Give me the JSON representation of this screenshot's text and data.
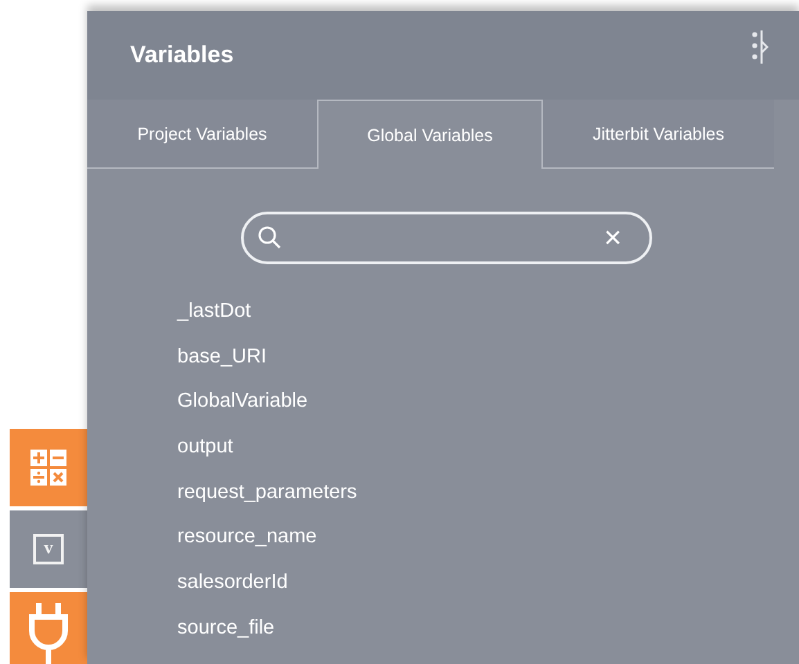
{
  "tools": [
    {
      "kind": "calculator",
      "selected": false
    },
    {
      "kind": "variable",
      "label": "v",
      "selected": true
    },
    {
      "kind": "plug",
      "selected": false
    }
  ],
  "panel": {
    "title": "Variables"
  },
  "tabs": [
    {
      "label": "Project Variables",
      "selected": false
    },
    {
      "label": "Global Variables",
      "selected": true
    },
    {
      "label": "Jitterbit Variables",
      "selected": false
    }
  ],
  "search": {
    "clear": "×"
  },
  "variables": [
    "_lastDot",
    "base_URI",
    "GlobalVariable",
    "output",
    "request_parameters",
    "resource_name",
    "salesorderId",
    "source_file"
  ]
}
